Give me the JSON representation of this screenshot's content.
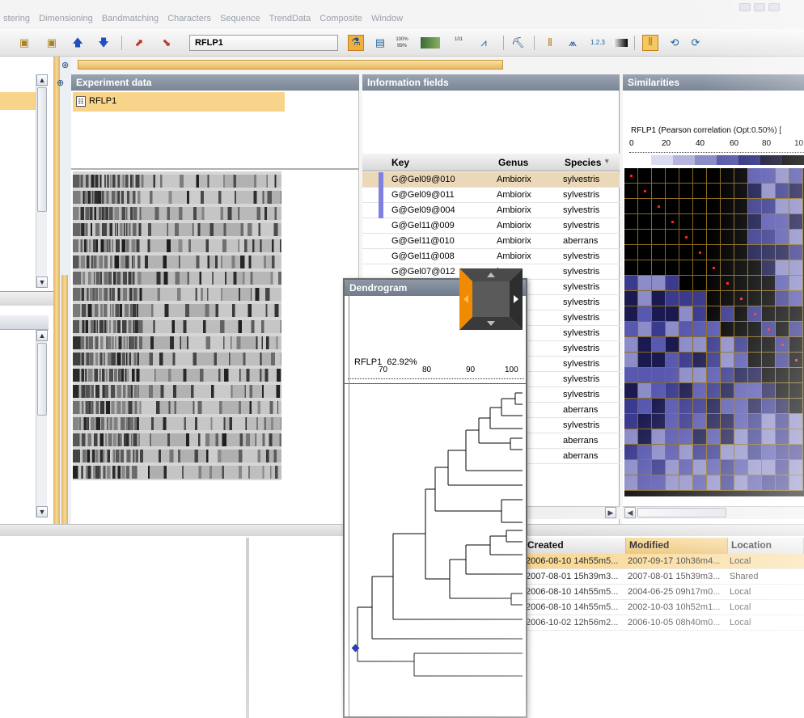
{
  "menu": [
    "stering",
    "Dimensioning",
    "Bandmatching",
    "Characters",
    "Sequence",
    "TrendData",
    "Composite",
    "Window"
  ],
  "toolbar": {
    "experiment_combo": "RFLP1",
    "zoom_100_label": "100%",
    "zoom_99_label": "99%",
    "binary_label": "101",
    "numbers_label": "1.2.3"
  },
  "panels": {
    "experiment_data": {
      "title": "Experiment data",
      "item": "RFLP1"
    },
    "information_fields": {
      "title": "Information fields",
      "columns": [
        "Key",
        "Genus",
        "Species"
      ],
      "rows": [
        {
          "key": "G@Gel09@010",
          "genus": "Ambiorix",
          "species": "sylvestris"
        },
        {
          "key": "G@Gel09@011",
          "genus": "Ambiorix",
          "species": "sylvestris"
        },
        {
          "key": "G@Gel09@004",
          "genus": "Ambiorix",
          "species": "sylvestris"
        },
        {
          "key": "G@Gel11@009",
          "genus": "Ambiorix",
          "species": "sylvestris"
        },
        {
          "key": "G@Gel11@010",
          "genus": "Ambiorix",
          "species": "aberrans"
        },
        {
          "key": "G@Gel11@008",
          "genus": "Ambiorix",
          "species": "sylvestris"
        },
        {
          "key": "G@Gel07@012",
          "genus": "ix",
          "species": "sylvestris"
        },
        {
          "key": "",
          "genus": "ix",
          "species": "sylvestris"
        },
        {
          "key": "",
          "genus": "ix",
          "species": "sylvestris"
        },
        {
          "key": "",
          "genus": "ix",
          "species": "sylvestris"
        },
        {
          "key": "",
          "genus": "ix",
          "species": "sylvestris"
        },
        {
          "key": "",
          "genus": "ix",
          "species": "sylvestris"
        },
        {
          "key": "",
          "genus": "ix",
          "species": "sylvestris"
        },
        {
          "key": "",
          "genus": "ix",
          "species": "sylvestris"
        },
        {
          "key": "",
          "genus": "ix",
          "species": "sylvestris"
        },
        {
          "key": "",
          "genus": "ix",
          "species": "aberrans"
        },
        {
          "key": "",
          "genus": "ix",
          "species": "sylvestris"
        },
        {
          "key": "",
          "genus": "ix",
          "species": "aberrans"
        },
        {
          "key": "",
          "genus": "ix",
          "species": "aberrans"
        }
      ]
    },
    "similarities": {
      "title": "Similarities",
      "caption": "RFLP1 (Pearson correlation (Opt:0.50%) [",
      "scale_ticks": [
        "0",
        "20",
        "40",
        "60",
        "80",
        "10"
      ]
    },
    "dendrogram": {
      "title": "Dendrogram",
      "caption": "RFLP1",
      "cophenetic": "62.92%",
      "scale_ticks": [
        "70",
        "80",
        "90",
        "100"
      ]
    }
  },
  "database_table": {
    "columns": [
      "Created",
      "Modified",
      "Location"
    ],
    "rows": [
      {
        "created": "2006-08-10 14h55m5...",
        "modified": "2007-09-17 10h36m4...",
        "location": "Local"
      },
      {
        "created": "2007-08-01 15h39m3...",
        "modified": "2007-08-01 15h39m3...",
        "location": "Shared"
      },
      {
        "created": "2006-08-10 14h55m5...",
        "modified": "2004-06-25 09h17m0...",
        "location": "Local"
      },
      {
        "created": "2006-08-10 14h55m5...",
        "modified": "2002-10-03 10h52m1...",
        "location": "Local"
      },
      {
        "created": "2006-10-02 12h56m2...",
        "modified": "2006-10-05 08h40m0...",
        "location": "Local"
      }
    ]
  },
  "colors": {
    "selection": "#f8d48a",
    "panel_header": "#7a8595",
    "matrix_high": "#000000",
    "matrix_mid": "#3a3a8e",
    "matrix_low": "#8c8cc8",
    "accent_orange": "#f08a00"
  }
}
